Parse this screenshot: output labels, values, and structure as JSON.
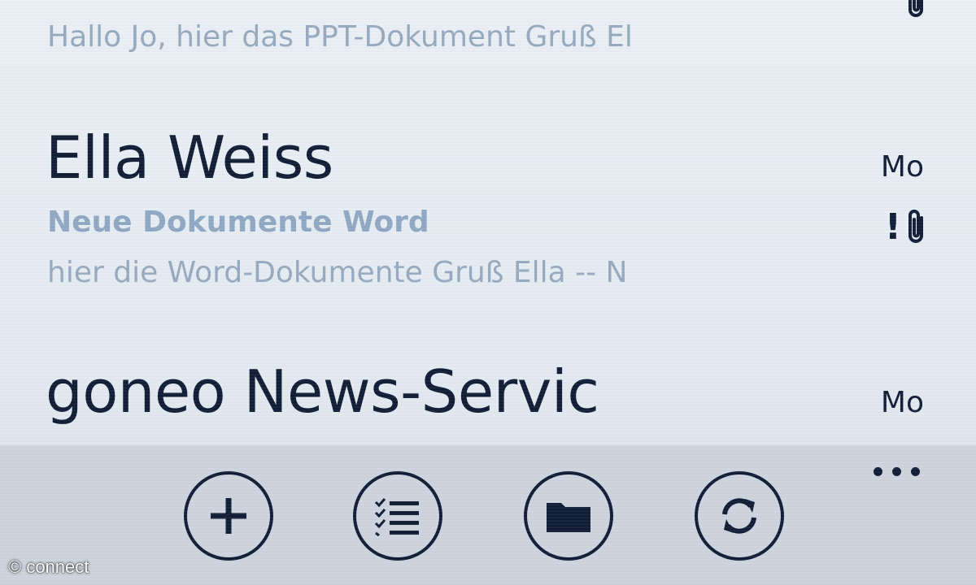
{
  "emails": [
    {
      "sender": "",
      "subject": "",
      "preview": "Hallo Jo, hier das PPT-Dokument Gruß El",
      "date": "",
      "has_attachment": true,
      "important": false
    },
    {
      "sender": "Ella Weiss",
      "subject": "Neue Dokumente Word",
      "preview": "hier die Word-Dokumente Gruß Ella -- N",
      "date": "Mo",
      "has_attachment": true,
      "important": true,
      "important_mark": "!"
    },
    {
      "sender": "goneo News-Servic",
      "subject": "",
      "preview": "",
      "date": "Mo",
      "has_attachment": false,
      "important": false
    }
  ],
  "app_bar": {
    "buttons": [
      {
        "icon": "add-icon"
      },
      {
        "icon": "select-list-icon"
      },
      {
        "icon": "folder-icon"
      },
      {
        "icon": "sync-icon"
      }
    ],
    "more_icon": "ellipsis-icon"
  },
  "watermark": "© connect",
  "colors": {
    "background": "#e6edf3",
    "text_dark": "#0d1a33",
    "subject": "#8ea7c2",
    "preview": "#95a8bd",
    "app_bar": "#ccd3dc"
  }
}
